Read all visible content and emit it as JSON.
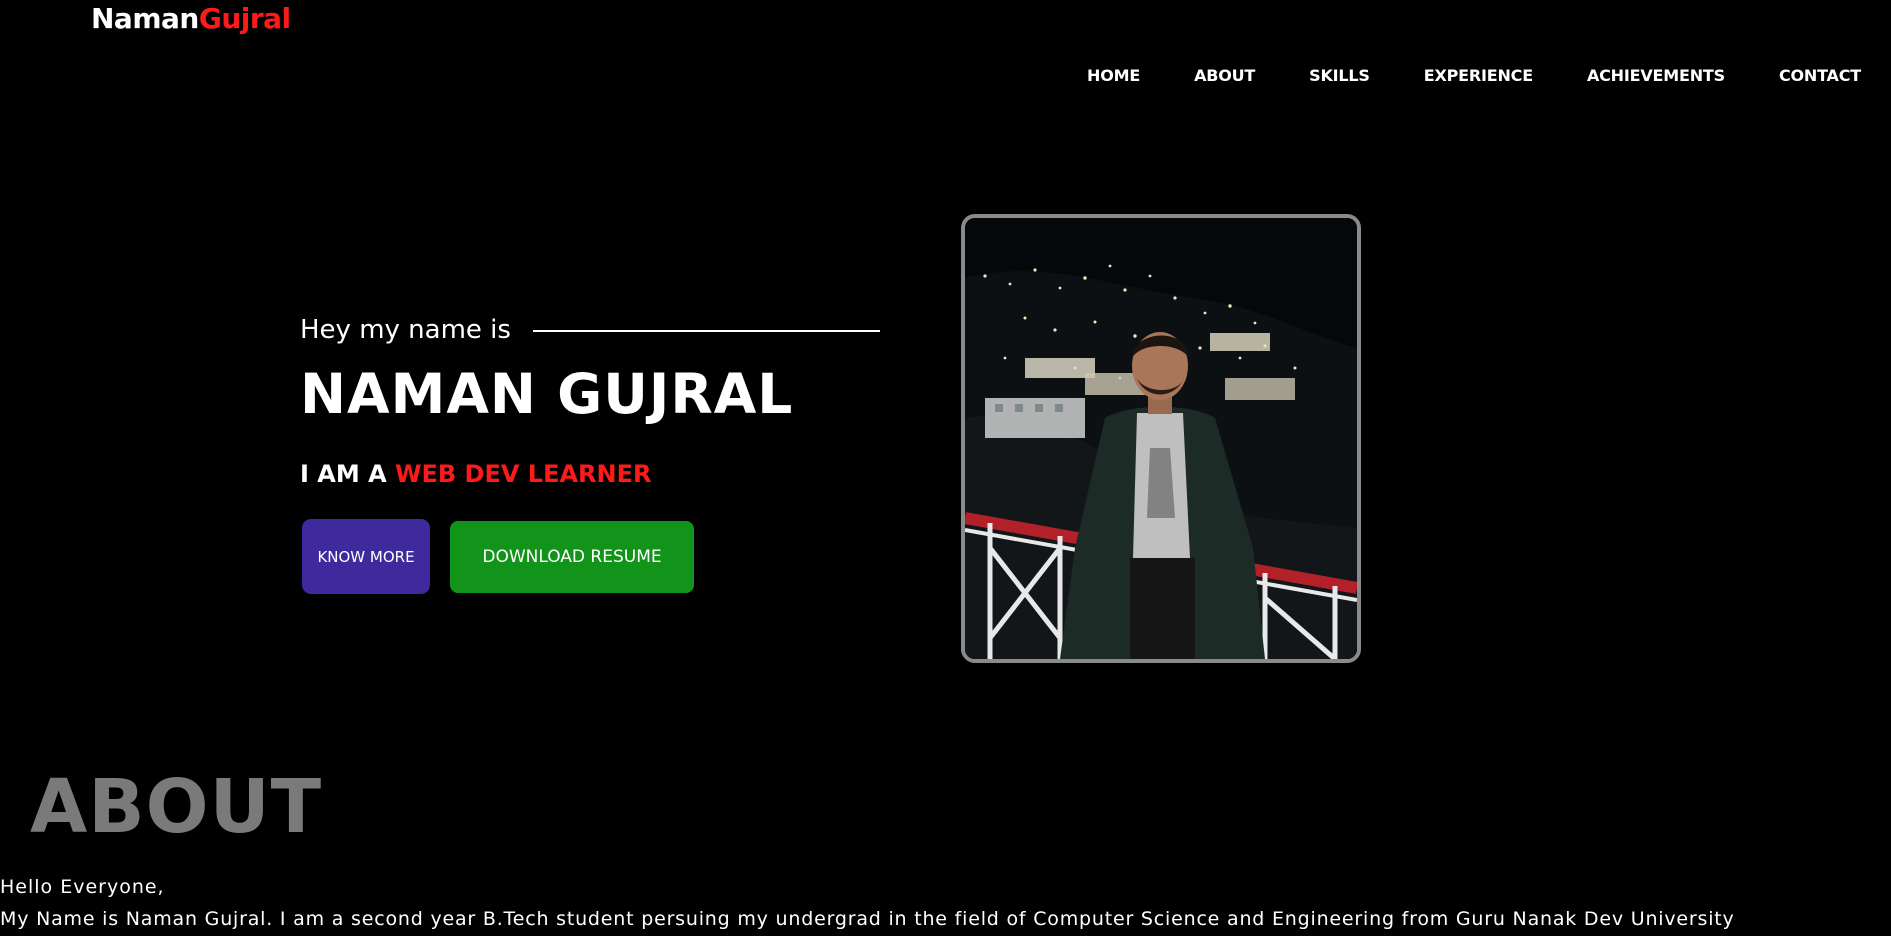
{
  "brand": {
    "first": "Naman",
    "last": "Gujral"
  },
  "nav": {
    "items": [
      {
        "label": "HOME"
      },
      {
        "label": "ABOUT"
      },
      {
        "label": "SKILLS"
      },
      {
        "label": "EXPERIENCE"
      },
      {
        "label": "ACHIEVEMENTS"
      },
      {
        "label": "CONTACT"
      }
    ]
  },
  "hero": {
    "intro": "Hey my name is",
    "name": "NAMAN GUJRAL",
    "role_prefix": "I AM A",
    "role_accent": "WEB DEV LEARNER",
    "know_more_label": "KNOW MORE",
    "download_resume_label": "DOWNLOAD RESUME"
  },
  "about": {
    "title": "ABOUT",
    "greeting": "Hello Everyone,",
    "paragraph": "My Name is Naman Gujral. I am a second year B.Tech student persuing my undergrad in the field of Computer Science and Engineering from Guru Nanak Dev University"
  },
  "colors": {
    "background": "#000000",
    "accent_red": "#ff1a1a",
    "know_more_bg": "#3e2a9c",
    "resume_bg": "#12931a",
    "about_title": "#7a7a7a"
  }
}
